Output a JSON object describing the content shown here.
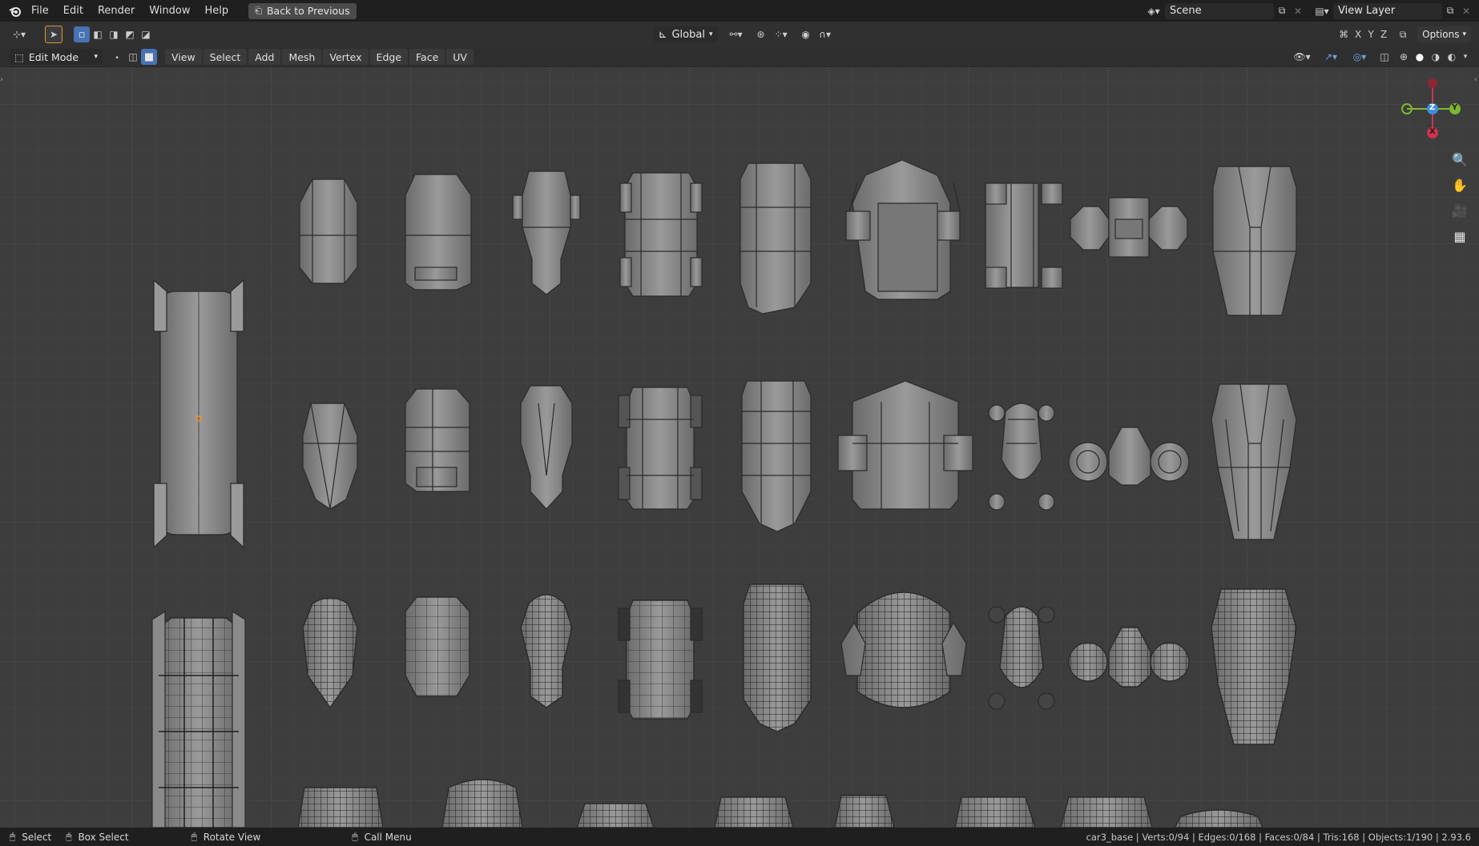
{
  "menubar": {
    "items": [
      "File",
      "Edit",
      "Render",
      "Window",
      "Help"
    ],
    "back_button": "Back to Previous",
    "scene_label": "Scene",
    "view_layer_label": "View Layer"
  },
  "toolbar": {
    "transform_orientation": "Global",
    "axis_x": "X",
    "axis_y": "Y",
    "axis_z": "Z",
    "options_label": "Options"
  },
  "header": {
    "mode": "Edit Mode",
    "menus": [
      "View",
      "Select",
      "Add",
      "Mesh",
      "Vertex",
      "Edge",
      "Face",
      "UV"
    ]
  },
  "gizmo": {
    "x_label": "X",
    "y_label": "Y",
    "z_label": "Z",
    "x_color": "#d2314a",
    "y_color": "#7cb82f",
    "z_color": "#3c8ee0"
  },
  "status": {
    "select": "Select",
    "box_select": "Box Select",
    "rotate_view": "Rotate View",
    "call_menu": "Call Menu",
    "stats": "car3_base | Verts:0/94 | Edges:0/168 | Faces:0/84 | Tris:168 | Objects:1/190 | 2.93.6"
  },
  "colors": {
    "background": "#3d3d3d",
    "mesh_fill": "#8c8c8c",
    "mesh_dark": "#6e6e6e",
    "wire": "#1e1e1e",
    "accent": "#4772b3"
  }
}
